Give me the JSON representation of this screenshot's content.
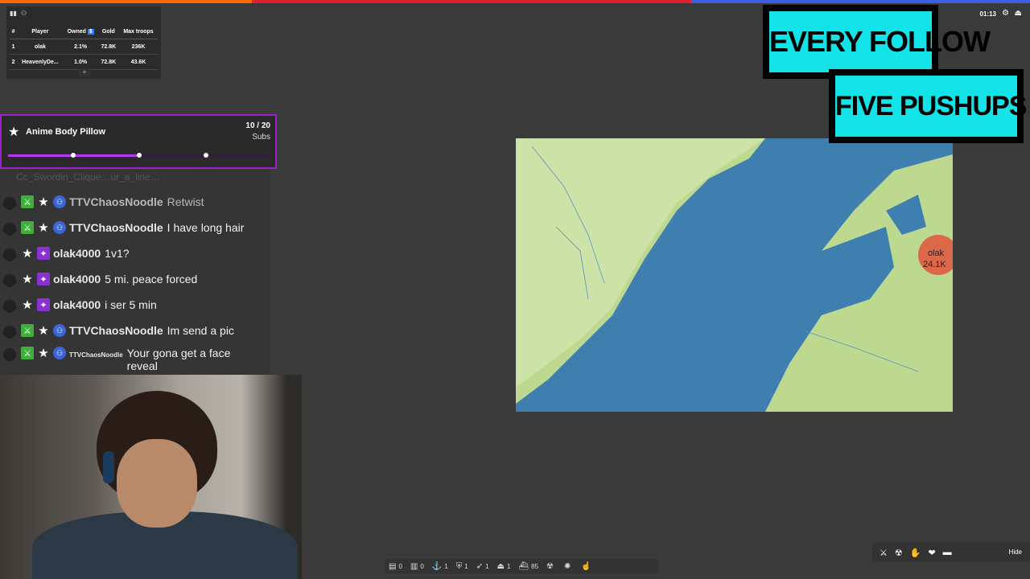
{
  "top_bar": {
    "colors": [
      "#ff6a00",
      "#e0202a",
      "#3c5ee6"
    ],
    "progress": [
      0.245,
      0.67,
      1.0
    ]
  },
  "leaderboard": {
    "icons": [
      "bar-chart-icon",
      "users-icon"
    ],
    "headers": [
      "#",
      "Player",
      "Owned",
      "Gold",
      "Max troops"
    ],
    "rows": [
      [
        "1",
        "olak",
        "2.1%",
        "72.8K",
        "236K"
      ],
      [
        "2",
        "HeavenlyDe...",
        "1.0%",
        "72.8K",
        "43.6K"
      ]
    ],
    "add_label": "+"
  },
  "sub_goal": {
    "title": "Anime Body Pillow",
    "current": 10,
    "target": 20,
    "count_text": "10 / 20",
    "unit": "Subs",
    "accent": "#9b22c9"
  },
  "chat": {
    "faded_line": "Cc_Swordin_Clique…ur_a_line…",
    "messages": [
      {
        "user": "TTVChaosNoodle",
        "text": "Retwist",
        "dim": true,
        "badges": [
          "sword",
          "star",
          "hands"
        ]
      },
      {
        "user": "TTVChaosNoodle",
        "text": "I have long hair",
        "dim": false,
        "badges": [
          "sword",
          "star",
          "hands"
        ]
      },
      {
        "user": "olak4000",
        "text": "1v1?",
        "dim": false,
        "badges": [
          "star",
          "sub"
        ]
      },
      {
        "user": "olak4000",
        "text": "5 mi. peace forced",
        "dim": false,
        "badges": [
          "star",
          "sub"
        ]
      },
      {
        "user": "olak4000",
        "text": "i ser 5 min",
        "dim": false,
        "badges": [
          "star",
          "sub"
        ]
      },
      {
        "user": "TTVChaosNoodle",
        "text": "Im send a pic",
        "dim": false,
        "badges": [
          "sword",
          "star",
          "hands"
        ]
      },
      {
        "user": "TTVChaosNoodle",
        "text": "Your gona get a face reveal",
        "dim": false,
        "badges": [
          "sword",
          "star",
          "hands"
        ],
        "small_name": true
      }
    ]
  },
  "overlay": {
    "line1": "EVERY FOLLOW",
    "line2": "FIVE PUSHUPS"
  },
  "game_hud": {
    "timer": "01:13",
    "map_label_name": "olak",
    "map_label_troops": "24.1K",
    "bottom_items": [
      {
        "icon": "city-icon",
        "value": "0"
      },
      {
        "icon": "factory-icon",
        "value": "0"
      },
      {
        "icon": "port-icon",
        "value": "1"
      },
      {
        "icon": "defense-icon",
        "value": "1"
      },
      {
        "icon": "missile-icon",
        "value": "1"
      },
      {
        "icon": "sam-icon",
        "value": "1"
      },
      {
        "icon": "warship-icon",
        "value": "85"
      },
      {
        "icon": "nuke-icon",
        "value": ""
      },
      {
        "icon": "mirv-icon",
        "value": ""
      },
      {
        "icon": "hand-icon",
        "value": ""
      }
    ],
    "hide_label": "Hide"
  }
}
